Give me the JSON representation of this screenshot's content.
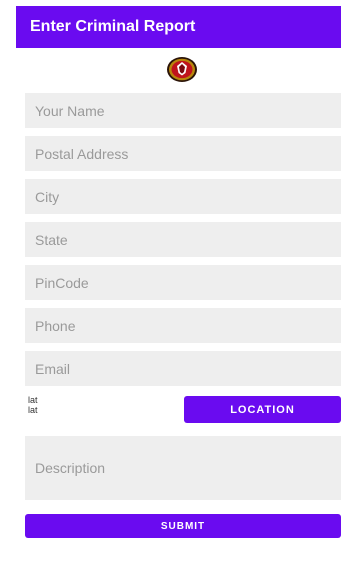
{
  "app_bar": {
    "title": "Enter Criminal Report"
  },
  "emblem": {
    "icon": "police-emblem-icon"
  },
  "form": {
    "fields": [
      {
        "placeholder": "Your Name"
      },
      {
        "placeholder": "Postal Address"
      },
      {
        "placeholder": "City"
      },
      {
        "placeholder": "State"
      },
      {
        "placeholder": "PinCode"
      },
      {
        "placeholder": "Phone"
      },
      {
        "placeholder": "Email"
      }
    ],
    "lat_label_1": "lat",
    "lat_label_2": "lat",
    "location_button": "LOCATION",
    "description_placeholder": "Description",
    "submit_button": "SUBMIT"
  },
  "colors": {
    "accent": "#6a0bf0",
    "field_bg": "#eeeeee",
    "placeholder": "#9a9a9a"
  }
}
